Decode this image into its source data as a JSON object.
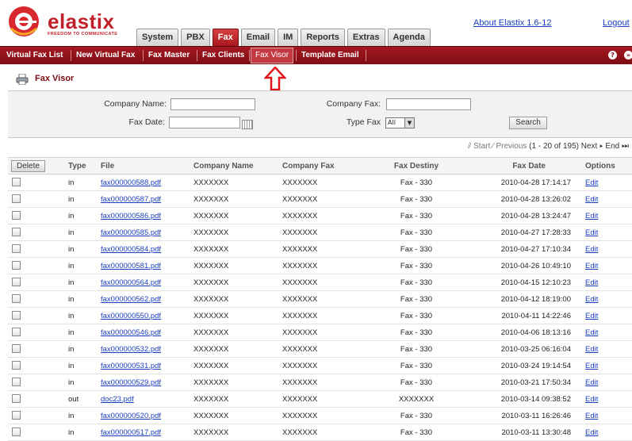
{
  "brand": {
    "name": "elastix",
    "tagline": "FREEDOM TO COMMUNICATE",
    "color": "#c0202a"
  },
  "top_links": {
    "about": "About Elastix 1.6-12",
    "logout": "Logout"
  },
  "tabs": [
    {
      "label": "System",
      "active": false
    },
    {
      "label": "PBX",
      "active": false
    },
    {
      "label": "Fax",
      "active": true
    },
    {
      "label": "Email",
      "active": false
    },
    {
      "label": "IM",
      "active": false
    },
    {
      "label": "Reports",
      "active": false
    },
    {
      "label": "Extras",
      "active": false
    },
    {
      "label": "Agenda",
      "active": false
    }
  ],
  "subnav": [
    {
      "label": "Virtual Fax List",
      "active": false
    },
    {
      "label": "New Virtual Fax",
      "active": false
    },
    {
      "label": "Fax Master",
      "active": false
    },
    {
      "label": "Fax Clients",
      "active": false
    },
    {
      "label": "Fax Visor",
      "active": true
    },
    {
      "label": "Template Email",
      "active": false
    }
  ],
  "page": {
    "title": "Fax Visor"
  },
  "filter": {
    "company_name_label": "Company Name:",
    "company_fax_label": "Company Fax:",
    "fax_date_label": "Fax Date:",
    "type_fax_label": "Type Fax",
    "type_fax_value": "All",
    "search_label": "Search"
  },
  "pager": {
    "start": "Start",
    "previous": "Previous",
    "range": "(1 - 20 of 195)",
    "next": "Next",
    "end": "End"
  },
  "table": {
    "delete_label": "Delete",
    "headers": [
      "Type",
      "File",
      "Company Name",
      "Company Fax",
      "Fax Destiny",
      "Fax Date",
      "Options"
    ],
    "rows": [
      {
        "type": "in",
        "file": "fax000000588.pdf",
        "company": "XXXXXXX",
        "fax": "XXXXXXX",
        "destiny": "Fax - 330",
        "date": "2010-04-28 17:14:17",
        "option": "Edit"
      },
      {
        "type": "in",
        "file": "fax000000587.pdf",
        "company": "XXXXXXX",
        "fax": "XXXXXXX",
        "destiny": "Fax - 330",
        "date": "2010-04-28 13:26:02",
        "option": "Edit"
      },
      {
        "type": "in",
        "file": "fax000000586.pdf",
        "company": "XXXXXXX",
        "fax": "XXXXXXX",
        "destiny": "Fax - 330",
        "date": "2010-04-28 13:24:47",
        "option": "Edit"
      },
      {
        "type": "in",
        "file": "fax000000585.pdf",
        "company": "XXXXXXX",
        "fax": "XXXXXXX",
        "destiny": "Fax - 330",
        "date": "2010-04-27 17:28:33",
        "option": "Edit"
      },
      {
        "type": "in",
        "file": "fax000000584.pdf",
        "company": "XXXXXXX",
        "fax": "XXXXXXX",
        "destiny": "Fax - 330",
        "date": "2010-04-27 17:10:34",
        "option": "Edit"
      },
      {
        "type": "in",
        "file": "fax000000581.pdf",
        "company": "XXXXXXX",
        "fax": "XXXXXXX",
        "destiny": "Fax - 330",
        "date": "2010-04-26 10:49:10",
        "option": "Edit"
      },
      {
        "type": "in",
        "file": "fax000000564.pdf",
        "company": "XXXXXXX",
        "fax": "XXXXXXX",
        "destiny": "Fax - 330",
        "date": "2010-04-15 12:10:23",
        "option": "Edit"
      },
      {
        "type": "in",
        "file": "fax000000562.pdf",
        "company": "XXXXXXX",
        "fax": "XXXXXXX",
        "destiny": "Fax - 330",
        "date": "2010-04-12 18:19:00",
        "option": "Edit"
      },
      {
        "type": "in",
        "file": "fax000000550.pdf",
        "company": "XXXXXXX",
        "fax": "XXXXXXX",
        "destiny": "Fax - 330",
        "date": "2010-04-11 14:22:46",
        "option": "Edit"
      },
      {
        "type": "in",
        "file": "fax000000546.pdf",
        "company": "XXXXXXX",
        "fax": "XXXXXXX",
        "destiny": "Fax - 330",
        "date": "2010-04-06 18:13:16",
        "option": "Edit"
      },
      {
        "type": "in",
        "file": "fax000000532.pdf",
        "company": "XXXXXXX",
        "fax": "XXXXXXX",
        "destiny": "Fax - 330",
        "date": "2010-03-25 06:16:04",
        "option": "Edit"
      },
      {
        "type": "in",
        "file": "fax000000531.pdf",
        "company": "XXXXXXX",
        "fax": "XXXXXXX",
        "destiny": "Fax - 330",
        "date": "2010-03-24 19:14:54",
        "option": "Edit"
      },
      {
        "type": "in",
        "file": "fax000000529.pdf",
        "company": "XXXXXXX",
        "fax": "XXXXXXX",
        "destiny": "Fax - 330",
        "date": "2010-03-21 17:50:34",
        "option": "Edit"
      },
      {
        "type": "out",
        "file": "doc23.pdf",
        "company": "XXXXXXX",
        "fax": "XXXXXXX",
        "destiny": "XXXXXXX",
        "date": "2010-03-14 09:38:52",
        "option": "Edit"
      },
      {
        "type": "in",
        "file": "fax000000520.pdf",
        "company": "XXXXXXX",
        "fax": "XXXXXXX",
        "destiny": "Fax - 330",
        "date": "2010-03-11 16:26:46",
        "option": "Edit"
      },
      {
        "type": "in",
        "file": "fax000000517.pdf",
        "company": "XXXXXXX",
        "fax": "XXXXXXX",
        "destiny": "Fax - 330",
        "date": "2010-03-11 13:30:48",
        "option": "Edit"
      }
    ]
  }
}
